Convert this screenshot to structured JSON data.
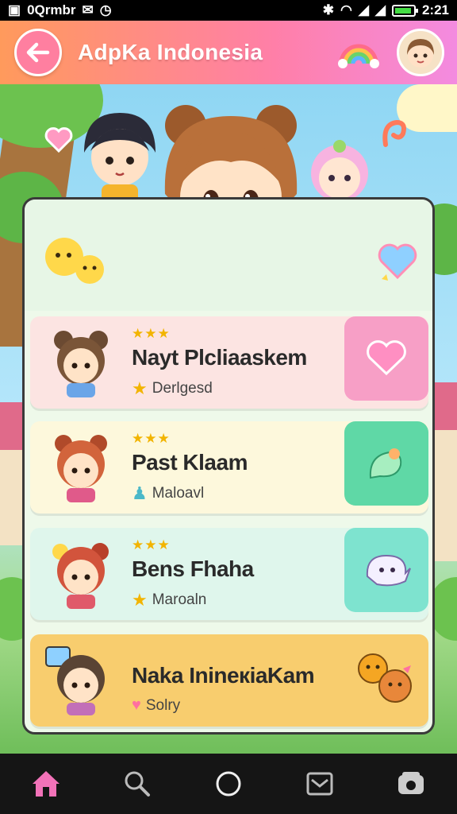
{
  "status_bar": {
    "left_text": "0Qrmbr",
    "time": "2:21"
  },
  "header": {
    "title": "AdpKa Indonesia"
  },
  "items": [
    {
      "stars": "★★★",
      "name": "Nayt Plcliaaskem",
      "sub": "Derlgesd",
      "sub_icon": "star-icon",
      "bg": "#fce4e2",
      "action_bg": "#f79fc6",
      "action_icon": "heart-icon"
    },
    {
      "stars": "★★★",
      "name": "Past Klaam",
      "sub": "Maloavl",
      "sub_icon": "figure-icon",
      "bg": "#fdf8dc",
      "action_bg": "#5fd8a6",
      "action_icon": "leaf-icon"
    },
    {
      "stars": "★★★",
      "name": "Bens Fhaha",
      "sub": "Maroaln",
      "sub_icon": "star-icon",
      "bg": "#dff6ec",
      "action_bg": "#7ee3cf",
      "action_icon": "ghost-icon"
    },
    {
      "stars": "",
      "name": "Naka InineкiaKam",
      "sub": "Solry",
      "sub_icon": "heart-icon",
      "bg": "#f8cd6e",
      "action_bg": "#f8cd6e",
      "action_icon": "pets-icon"
    }
  ],
  "colors": {
    "accent_pink": "#ff7fa8",
    "accent_orange": "#ff9a5c"
  }
}
